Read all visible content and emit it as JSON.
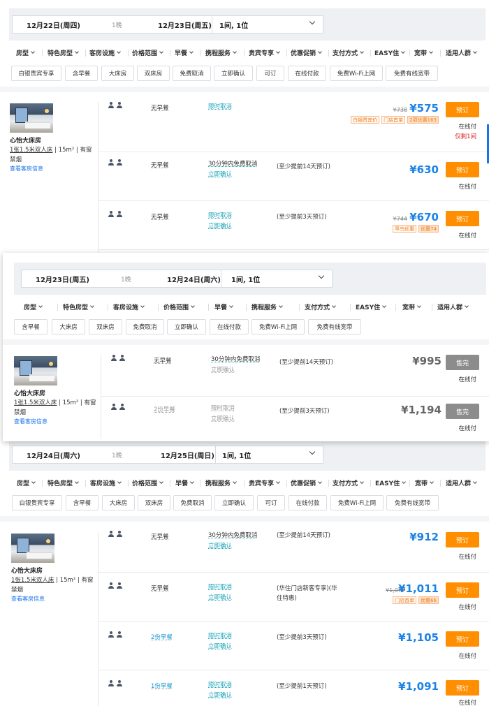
{
  "filters_a": [
    "房型",
    "特色房型",
    "客房设施",
    "价格范围",
    "早餐",
    "携程服务",
    "贵宾专享",
    "优惠促销",
    "支付方式",
    "EASY住",
    "宽带",
    "适用人群"
  ],
  "filters_b": [
    "房型",
    "特色房型",
    "客房设施",
    "价格范围",
    "早餐",
    "携程服务",
    "支付方式",
    "EASY住",
    "宽带",
    "适用人群"
  ],
  "tags_a": [
    "白银贵宾专享",
    "含早餐",
    "大床房",
    "双床房",
    "免费取消",
    "立即确认",
    "可订",
    "在线付款",
    "免费Wi-Fi上网",
    "免费有线宽带"
  ],
  "tags_b": [
    "含早餐",
    "大床房",
    "双床房",
    "免费取消",
    "立即确认",
    "在线付款",
    "免费Wi-Fi上网",
    "免费有线宽带"
  ],
  "room": {
    "name": "心怡大床房",
    "bed": "1张1.5米双人床",
    "area": "15m²",
    "window": "有窗",
    "smoke": "禁烟",
    "link": "查看客房信息"
  },
  "pay_label": "在线付",
  "sections": [
    {
      "checkin": "12月22日(周四)",
      "nights": "1晚",
      "checkout": "12月23日(周五)",
      "rooms": "1间, 1位",
      "room_window": "有窗",
      "rows": [
        {
          "breakfast": "无早餐",
          "cancel": [
            "限时取消"
          ],
          "condition": "",
          "orig": "¥738",
          "price": "¥575",
          "badges": [
            "白银贵宾价",
            "门店首单",
            "2项优惠163"
          ],
          "button": "预订",
          "remain": "仅剩1间"
        },
        {
          "breakfast": "无早餐",
          "cancel": [
            "30分钟内免费取消",
            "立即确认"
          ],
          "condition": "(至少提前14天预订)",
          "orig": "",
          "price": "¥630",
          "badges": [],
          "button": "预订",
          "remain": ""
        },
        {
          "breakfast": "无早餐",
          "cancel": [
            "限时取消",
            "立即确认"
          ],
          "condition": "(至少提前3天预订)",
          "orig": "¥744",
          "price": "¥670",
          "badges": [
            "早鸟优惠",
            "优惠74"
          ],
          "button": "预订",
          "remain": ""
        }
      ]
    },
    {
      "checkin": "12月23日(周五)",
      "nights": "1晚",
      "checkout": "12月24日(周六)",
      "rooms": "1间, 1位",
      "room_window": "有窗",
      "rows": [
        {
          "breakfast": "无早餐",
          "cancel": [
            "30分钟内免费取消",
            "立即确认"
          ],
          "condition": "(至少提前14天预订)",
          "orig": "",
          "price": "¥995",
          "badges": [],
          "button": "售完",
          "remain": ""
        },
        {
          "breakfast": "2份早餐",
          "cancel": [
            "限时取消",
            "立即确认"
          ],
          "condition": "(至少提前3天预订)",
          "orig": "",
          "price": "¥1,194",
          "badges": [],
          "button": "售完",
          "remain": ""
        }
      ]
    },
    {
      "checkin": "12月24日(周六)",
      "nights": "1晚",
      "checkout": "12月25日(周日)",
      "rooms": "1间, 1位",
      "room_window": "有窗",
      "rows": [
        {
          "breakfast": "无早餐",
          "cancel": [
            "30分钟内免费取消",
            "立即确认"
          ],
          "condition": "(至少提前14天预订)",
          "orig": "",
          "price": "¥912",
          "badges": [],
          "button": "预订",
          "remain": ""
        },
        {
          "breakfast": "无早餐",
          "cancel": [
            "限时取消",
            "立即确认"
          ],
          "condition": "(华住门店新客专享)(华住特惠)",
          "orig": "¥1,077",
          "price": "¥1,011",
          "badges": [
            "门店首单",
            "优惠66"
          ],
          "button": "预订",
          "remain": ""
        },
        {
          "breakfast": "2份早餐",
          "cancel": [
            "限时取消",
            "立即确认"
          ],
          "condition": "(至少提前3天预订)",
          "orig": "",
          "price": "¥1,105",
          "badges": [],
          "button": "预订",
          "remain": ""
        },
        {
          "breakfast": "1份早餐",
          "cancel": [
            "限时取消",
            "立即确认"
          ],
          "condition": "(至少提前1天预订)",
          "orig": "",
          "price": "¥1,091",
          "badges": [],
          "button": "预订",
          "remain": ""
        }
      ]
    }
  ],
  "colors": {
    "accent": "#1b82e6",
    "book": "#ff8f00",
    "soldout": "#8c8c8c",
    "cancel": "#1aa3b8",
    "promo": "#f07b1a"
  }
}
